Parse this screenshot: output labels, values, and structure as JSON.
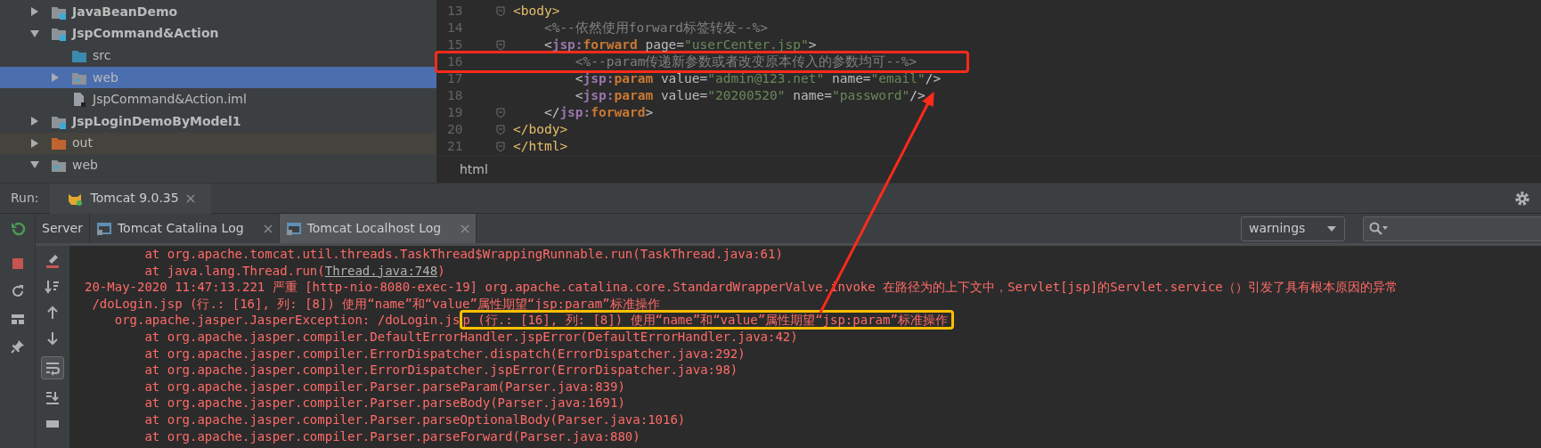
{
  "project_tree": [
    {
      "label": "JavaBeanDemo",
      "kind": "module",
      "expanded": false,
      "selected": false
    },
    {
      "label": "JspCommand&Action",
      "kind": "module",
      "expanded": true,
      "selected": false,
      "children": [
        {
          "label": "src",
          "kind": "source-folder",
          "selected": false
        },
        {
          "label": "web",
          "kind": "web-folder",
          "expanded": false,
          "selected": true
        },
        {
          "label": "JspCommand&Action.iml",
          "kind": "file",
          "selected": false
        }
      ]
    },
    {
      "label": "JspLoginDemoByModel1",
      "kind": "module",
      "expanded": false,
      "selected": false
    },
    {
      "label": "out",
      "kind": "excluded-folder",
      "expanded": false,
      "selected": false
    },
    {
      "label": "web",
      "kind": "web-folder",
      "expanded": true,
      "selected": false
    }
  ],
  "editor": {
    "lines": [
      {
        "number": "13",
        "fold": true,
        "highlight": false,
        "tokens": [
          {
            "t": "<body>",
            "kind": "tag"
          }
        ]
      },
      {
        "number": "14",
        "fold": false,
        "highlight": false,
        "tokens": [
          {
            "t": "    <%--依然使用forward标签转发--%>",
            "kind": "comment"
          }
        ]
      },
      {
        "number": "15",
        "fold": true,
        "highlight": false,
        "tokens": [
          {
            "t": "    <",
            "kind": "punct"
          },
          {
            "t": "jsp:",
            "kind": "ns"
          },
          {
            "t": "forward",
            "kind": "name"
          },
          {
            "t": " page=",
            "kind": "attr"
          },
          {
            "t": "\"userCenter.jsp\"",
            "kind": "value"
          },
          {
            "t": ">",
            "kind": "punct"
          }
        ]
      },
      {
        "number": "16",
        "fold": false,
        "highlight": true,
        "tokens": [
          {
            "t": "        <%--param传递新参数或者改变原本传入的参数均可--%>",
            "kind": "comment"
          }
        ]
      },
      {
        "number": "17",
        "fold": false,
        "highlight": false,
        "tokens": [
          {
            "t": "        <",
            "kind": "punct"
          },
          {
            "t": "jsp:",
            "kind": "ns"
          },
          {
            "t": "param",
            "kind": "name"
          },
          {
            "t": " value=",
            "kind": "attr"
          },
          {
            "t": "\"admin@123.net\"",
            "kind": "value"
          },
          {
            "t": " name=",
            "kind": "attr"
          },
          {
            "t": "\"email\"",
            "kind": "value"
          },
          {
            "t": "/>",
            "kind": "punct"
          }
        ]
      },
      {
        "number": "18",
        "fold": false,
        "highlight": false,
        "tokens": [
          {
            "t": "        <",
            "kind": "punct"
          },
          {
            "t": "jsp:",
            "kind": "ns"
          },
          {
            "t": "param",
            "kind": "name"
          },
          {
            "t": " value=",
            "kind": "attr"
          },
          {
            "t": "\"20200520\"",
            "kind": "value"
          },
          {
            "t": " name=",
            "kind": "attr"
          },
          {
            "t": "\"password\"",
            "kind": "value"
          },
          {
            "t": "/>",
            "kind": "punct"
          }
        ]
      },
      {
        "number": "19",
        "fold": true,
        "highlight": false,
        "tokens": [
          {
            "t": "    </",
            "kind": "punct"
          },
          {
            "t": "jsp:",
            "kind": "ns"
          },
          {
            "t": "forward",
            "kind": "name"
          },
          {
            "t": ">",
            "kind": "punct"
          }
        ]
      },
      {
        "number": "20",
        "fold": true,
        "highlight": false,
        "tokens": [
          {
            "t": "</body>",
            "kind": "tag"
          }
        ]
      },
      {
        "number": "21",
        "fold": true,
        "highlight": false,
        "tokens": [
          {
            "t": "</html>",
            "kind": "tag"
          }
        ]
      }
    ],
    "breadcrumb": "html"
  },
  "run_panel": {
    "label": "Run:",
    "tabs": [
      {
        "label": "Tomcat 9.0.35",
        "selected": true
      }
    ],
    "log_tabs": [
      {
        "label": "Server",
        "kind": "plain",
        "selected": false
      },
      {
        "label": "Tomcat Catalina Log",
        "kind": "log",
        "selected": false
      },
      {
        "label": "Tomcat Localhost Log",
        "kind": "log",
        "selected": true
      }
    ],
    "filter": "warnings",
    "soft_wrap_on": true,
    "log_lines": [
      {
        "segments": [
          {
            "text": "        at org.apache.tomcat.util.threads.TaskThread$WrappingRunnable.run(TaskThread.java:61)",
            "kind": "text"
          }
        ]
      },
      {
        "segments": [
          {
            "text": "        at java.lang.Thread.run(",
            "kind": "text"
          },
          {
            "text": "Thread.java:748",
            "kind": "link"
          },
          {
            "text": ")",
            "kind": "text"
          }
        ]
      },
      {
        "segments": [
          {
            "text": "20-May-2020 11:47:13.221 严重 [http-nio-8080-exec-19] org.apache.catalina.core.StandardWrapperValve.invoke 在路径为的上下文中，Servlet[jsp]的Servlet.service（）引发了具有根本原因的异常",
            "kind": "text"
          }
        ]
      },
      {
        "segments": [
          {
            "text": " /doLogin.jsp (行.: [16], 列: [8]) 使用“name”和“value”属性期望“jsp:param”标准操作",
            "kind": "text"
          }
        ]
      },
      {
        "segments": [
          {
            "text": "    org.apache.jasper.JasperException: /doLogin.js",
            "kind": "text"
          },
          {
            "text": "p (行.: [16], 列: [8]) 使用“name”和“value”属性期望“jsp:param”标准操作",
            "kind": "highlight"
          }
        ]
      },
      {
        "segments": [
          {
            "text": "        at org.apache.jasper.compiler.DefaultErrorHandler.jspError(DefaultErrorHandler.java:42)",
            "kind": "text"
          }
        ]
      },
      {
        "segments": [
          {
            "text": "        at org.apache.jasper.compiler.ErrorDispatcher.dispatch(ErrorDispatcher.java:292)",
            "kind": "text"
          }
        ]
      },
      {
        "segments": [
          {
            "text": "        at org.apache.jasper.compiler.ErrorDispatcher.jspError(ErrorDispatcher.java:98)",
            "kind": "text"
          }
        ]
      },
      {
        "segments": [
          {
            "text": "        at org.apache.jasper.compiler.Parser.parseParam(Parser.java:839)",
            "kind": "text"
          }
        ]
      },
      {
        "segments": [
          {
            "text": "        at org.apache.jasper.compiler.Parser.parseBody(Parser.java:1691)",
            "kind": "text"
          }
        ]
      },
      {
        "segments": [
          {
            "text": "        at org.apache.jasper.compiler.Parser.parseOptionalBody(Parser.java:1016)",
            "kind": "text"
          }
        ]
      },
      {
        "segments": [
          {
            "text": "        at org.apache.jasper.compiler.Parser.parseForward(Parser.java:880)",
            "kind": "text"
          }
        ]
      }
    ]
  }
}
